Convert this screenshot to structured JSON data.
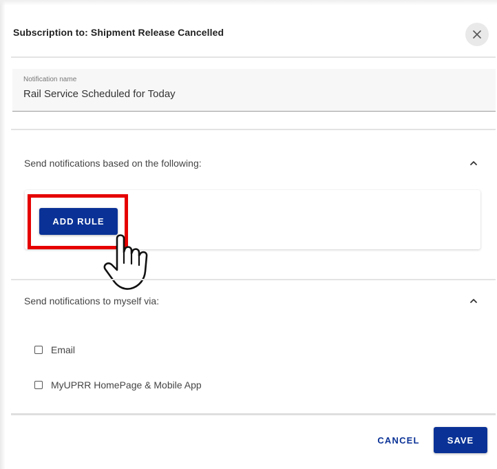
{
  "dialog": {
    "title": "Subscription to: Shipment Release Cancelled",
    "close_icon": "close-icon"
  },
  "notification_name": {
    "label": "Notification name",
    "value": "Rail Service Scheduled for Today"
  },
  "rules_section": {
    "label": "Send notifications based on the following:",
    "add_rule_label": "ADD RULE",
    "collapse_icon": "chevron-up-icon",
    "highlight_color": "#e60000"
  },
  "delivery_section": {
    "label": "Send notifications to myself via:",
    "collapse_icon": "chevron-up-icon",
    "options": [
      {
        "label": "Email",
        "checked": false
      },
      {
        "label": "MyUPRR HomePage & Mobile App",
        "checked": false
      }
    ]
  },
  "footer": {
    "cancel_label": "CANCEL",
    "save_label": "SAVE"
  },
  "colors": {
    "primary": "#0a3296",
    "highlight": "#e60000"
  },
  "pointer_icon": "hand-pointer-icon"
}
